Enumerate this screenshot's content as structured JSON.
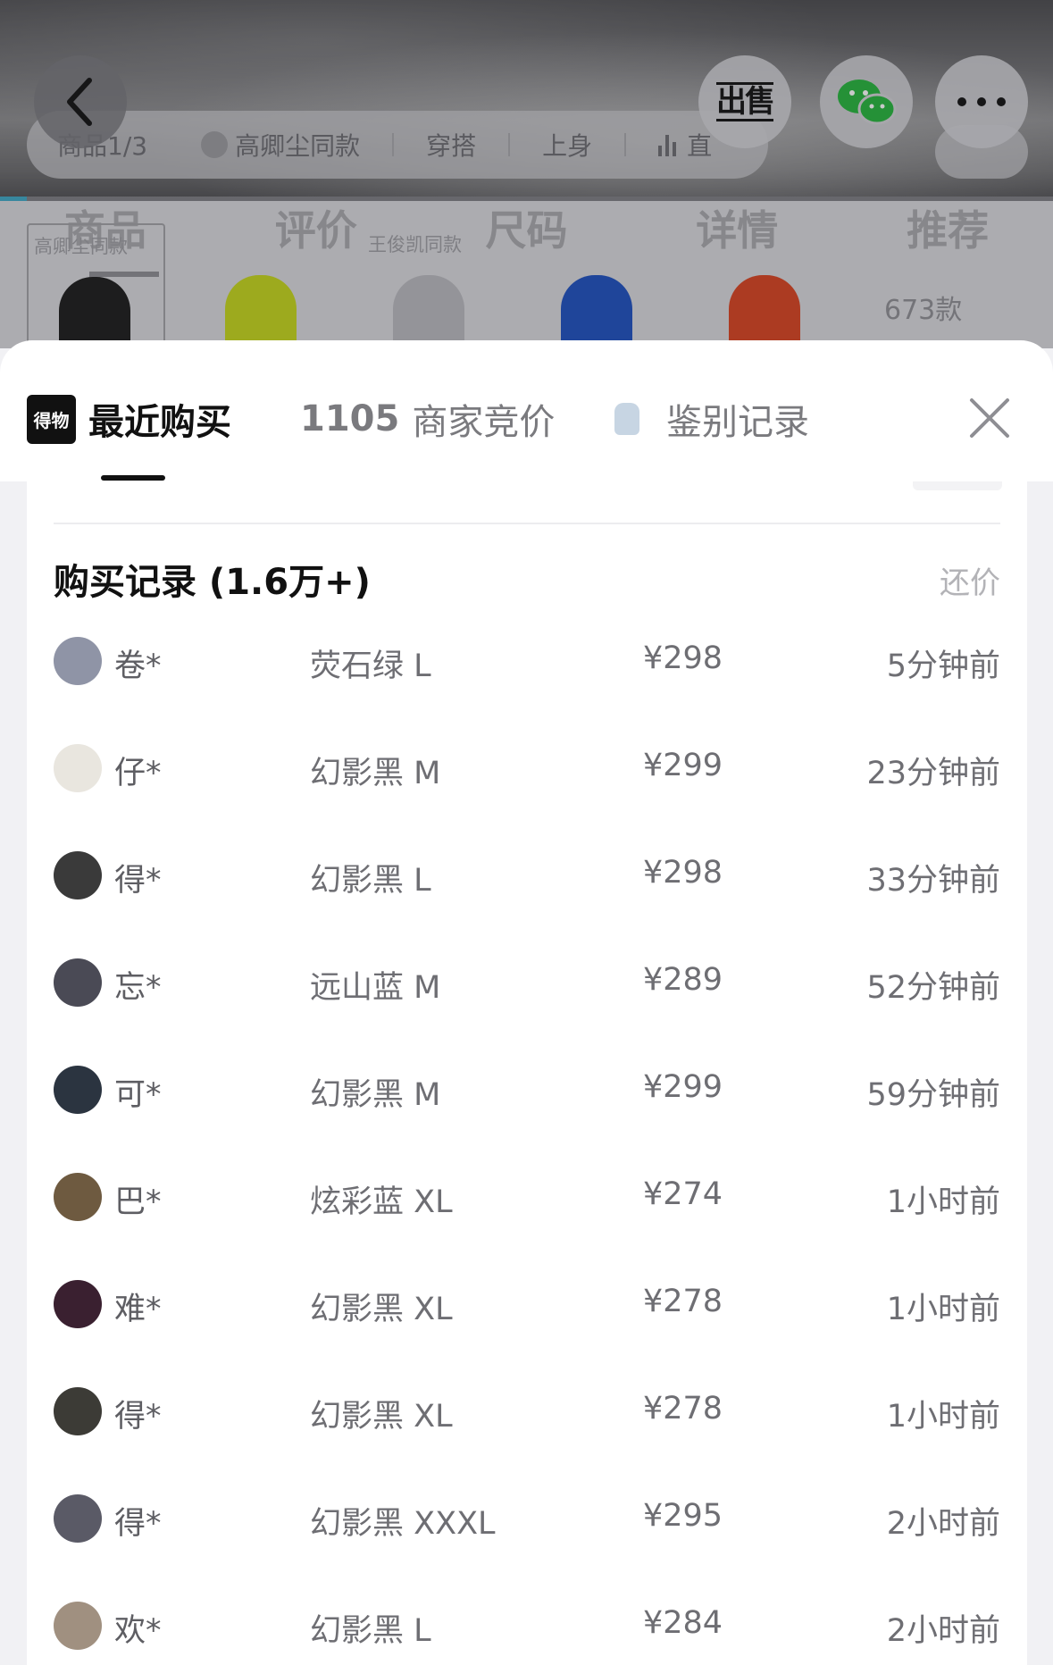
{
  "top_nav": {
    "counter": "商品1/3",
    "celebrity_tag": "高卿尘同款",
    "outfit": "穿搭",
    "try_on": "上身",
    "trend": "直"
  },
  "sell_button": "出售",
  "section_tabs": [
    "商品",
    "评价",
    "尺码",
    "详情",
    "推荐"
  ],
  "thumbnails": [
    {
      "tag": "高卿尘同款",
      "color": "#1a1a1a"
    },
    {
      "tag": "",
      "color": "#c4d61a"
    },
    {
      "tag": "王俊凯同款",
      "color": "#b8b8be"
    },
    {
      "tag": "",
      "color": "#1d4fbf"
    },
    {
      "tag": "",
      "color": "#d9421f"
    }
  ],
  "more_styles": "673款",
  "sheet_tabs": {
    "logo": "得物",
    "recent": "最近购买",
    "bids_count": "1105",
    "bids_label": "商家竞价",
    "auth": "鉴别记录"
  },
  "records": {
    "title": "购买记录 (1.6万+)",
    "counter_offer": "还价",
    "rows": [
      {
        "user": "卷*",
        "sku": "荧石绿 L",
        "price": "¥298",
        "time": "5分钟前",
        "avatar_color": "#8f94a6"
      },
      {
        "user": "仔*",
        "sku": "幻影黑 M",
        "price": "¥299",
        "time": "23分钟前",
        "avatar_color": "#e9e6df"
      },
      {
        "user": "得*",
        "sku": "幻影黑 L",
        "price": "¥298",
        "time": "33分钟前",
        "avatar_color": "#3a3a3a"
      },
      {
        "user": "忘*",
        "sku": "远山蓝 M",
        "price": "¥289",
        "time": "52分钟前",
        "avatar_color": "#4a4a55"
      },
      {
        "user": "可*",
        "sku": "幻影黑 M",
        "price": "¥299",
        "time": "59分钟前",
        "avatar_color": "#2b3440"
      },
      {
        "user": "巴*",
        "sku": "炫彩蓝 XL",
        "price": "¥274",
        "time": "1小时前",
        "avatar_color": "#6e5a40"
      },
      {
        "user": "难*",
        "sku": "幻影黑 XL",
        "price": "¥278",
        "time": "1小时前",
        "avatar_color": "#3a2030"
      },
      {
        "user": "得*",
        "sku": "幻影黑 XL",
        "price": "¥278",
        "time": "1小时前",
        "avatar_color": "#3c3b36"
      },
      {
        "user": "得*",
        "sku": "幻影黑 XXXL",
        "price": "¥295",
        "time": "2小时前",
        "avatar_color": "#5a5a66"
      },
      {
        "user": "欢*",
        "sku": "幻影黑 L",
        "price": "¥284",
        "time": "2小时前",
        "avatar_color": "#a09080"
      }
    ]
  }
}
